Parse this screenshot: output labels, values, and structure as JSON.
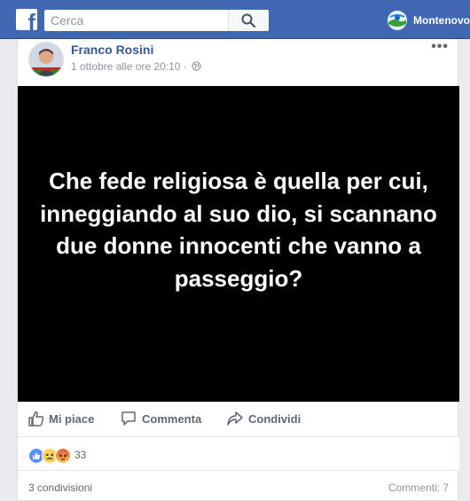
{
  "topbar": {
    "logo_icon": "facebook-f-logo",
    "search_placeholder": "Cerca",
    "search_value": "",
    "profile_name": "Montenovo",
    "bar_color": "#4267b2"
  },
  "post": {
    "author": "Franco Rosini",
    "timestamp": "1 ottobre alle ore 20:10",
    "separator": "·",
    "privacy_icon": "globe-icon",
    "more_label": "•••",
    "image_text": "Che fede religiosa è quella per cui, inneggiando al suo dio, si scannano due donne innocenti che vanno a passeggio?",
    "image_background": "#000000",
    "actions": {
      "like": "Mi piace",
      "comment": "Commenta",
      "share": "Condividi"
    },
    "reactions": {
      "icons": [
        "like-icon",
        "sad-icon",
        "angry-icon"
      ],
      "count": "33"
    },
    "shares": "3 condivisioni",
    "comments": "Commenti: 7"
  }
}
